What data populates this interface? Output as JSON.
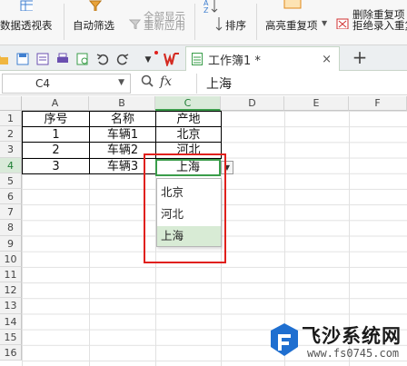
{
  "ribbon": {
    "items": [
      {
        "label": "数据透视表",
        "icon": "pivot-table-icon"
      },
      {
        "label": "自动筛选",
        "icon": "filter-icon"
      },
      {
        "label": "全部显示",
        "icon": "show-all-icon"
      },
      {
        "label": "重新应用",
        "icon": "reapply-icon"
      },
      {
        "label": "排序",
        "icon": "sort-icon"
      },
      {
        "label": "高亮重复项",
        "icon": "highlight-duplicates-icon"
      },
      {
        "label": "删除重复项",
        "icon": "remove-duplicates-icon"
      },
      {
        "label": "拒绝录入重复项",
        "icon": "reject-duplicates-icon"
      }
    ]
  },
  "tabbar": {
    "doc_title": "工作簿1 *",
    "close": "×",
    "new_tab": "+"
  },
  "formula_bar": {
    "cell_ref": "C4",
    "fx": "fx",
    "content": "上海"
  },
  "grid": {
    "columns": [
      "A",
      "B",
      "C",
      "D",
      "E",
      "F"
    ],
    "rows": [
      "1",
      "2",
      "3",
      "4",
      "5",
      "6",
      "7",
      "8",
      "9",
      "10",
      "11",
      "12",
      "13",
      "14",
      "15",
      "16"
    ],
    "selected_column": "C",
    "selected_row": "4",
    "table": [
      [
        "序号",
        "名称",
        "产地"
      ],
      [
        "1",
        "车辆1",
        "北京"
      ],
      [
        "2",
        "车辆2",
        "河北"
      ],
      [
        "3",
        "车辆3",
        "上海"
      ]
    ]
  },
  "dropdown": {
    "options": [
      "北京",
      "河北",
      "上海"
    ],
    "highlighted_index": 2
  },
  "watermark": {
    "name": "飞沙系统网",
    "url": "www.fs0745.com"
  },
  "colors": {
    "selection_green": "#3a9d4a",
    "highlight_red": "#e0201c",
    "option_highlight": "#d8ebd5"
  }
}
